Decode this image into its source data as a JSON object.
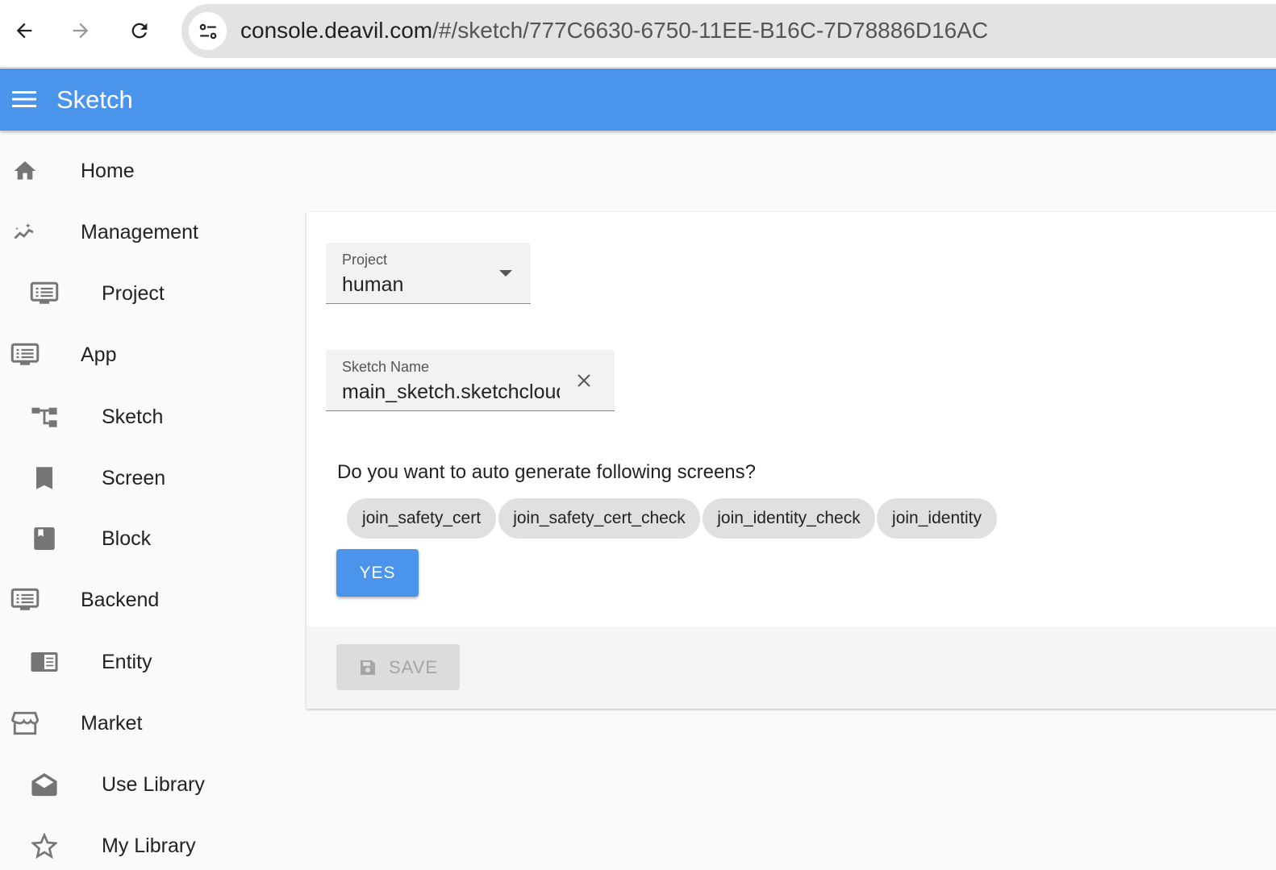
{
  "browser": {
    "url_host": "console.deavil.com",
    "url_path": "/#/sketch/777C6630-6750-11EE-B16C-7D78886D16AC"
  },
  "appbar": {
    "title": "Sketch"
  },
  "sidebar": {
    "items": [
      {
        "label": "Home",
        "icon": "home-icon"
      },
      {
        "label": "Management",
        "icon": "insights-icon"
      },
      {
        "label": "Project",
        "icon": "monitor-list-icon"
      },
      {
        "label": "App",
        "icon": "monitor-list-icon"
      },
      {
        "label": "Sketch",
        "icon": "account-tree-icon"
      },
      {
        "label": "Screen",
        "icon": "bookmark-icon"
      },
      {
        "label": "Block",
        "icon": "book-icon"
      },
      {
        "label": "Backend",
        "icon": "monitor-list-icon"
      },
      {
        "label": "Entity",
        "icon": "chrome-reader-icon"
      },
      {
        "label": "Market",
        "icon": "storefront-icon"
      },
      {
        "label": "Use Library",
        "icon": "drafts-icon"
      },
      {
        "label": "My Library",
        "icon": "star-icon"
      }
    ]
  },
  "form": {
    "project": {
      "label": "Project",
      "value": "human"
    },
    "sketch_name": {
      "label": "Sketch Name",
      "value": "main_sketch.sketchcloud"
    },
    "question": "Do you want to auto generate following screens?",
    "chips": [
      "join_safety_cert",
      "join_safety_cert_check",
      "join_identity_check",
      "join_identity"
    ],
    "yes_label": "YES",
    "save_label": "SAVE"
  },
  "colors": {
    "primary": "#4a94eb"
  }
}
